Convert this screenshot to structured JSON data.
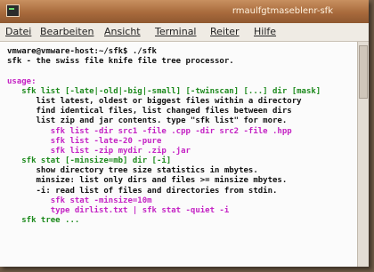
{
  "window": {
    "title": "rmaulfgtmaseblenr-sfk"
  },
  "menu": [
    "Datei",
    "Bearbeiten",
    "Ansicht",
    "Terminal",
    "Reiter",
    "Hilfe"
  ],
  "terminal": {
    "lines": [
      {
        "text": "vmware@vmware-host:~/sfk$ ./sfk",
        "color": "#111111"
      },
      {
        "text": "sfk - the swiss file knife file tree processor.",
        "color": "#111111"
      },
      {
        "text": "",
        "color": "#111111"
      },
      {
        "text": "usage:",
        "color": "#c423c4"
      },
      {
        "text": "   sfk list [-late|-old|-big|-small] [-twinscan] [...] dir [mask]",
        "color": "#1d8a1d"
      },
      {
        "text": "      list latest, oldest or biggest files within a directory",
        "color": "#111111"
      },
      {
        "text": "      find identical files, list changed files between dirs",
        "color": "#111111"
      },
      {
        "text": "      list zip and jar contents. type \"sfk list\" for more.",
        "color": "#111111"
      },
      {
        "text": "         sfk list -dir src1 -file .cpp -dir src2 -file .hpp",
        "color": "#c423c4"
      },
      {
        "text": "         sfk list -late-20 -pure",
        "color": "#c423c4"
      },
      {
        "text": "         sfk list -zip mydir .zip .jar",
        "color": "#c423c4"
      },
      {
        "text": "   sfk stat [-minsize=mb] dir [-i]",
        "color": "#1d8a1d"
      },
      {
        "text": "      show directory tree size statistics in mbytes.",
        "color": "#111111"
      },
      {
        "text": "      minsize: list only dirs and files >= minsize mbytes.",
        "color": "#111111"
      },
      {
        "text": "      -i: read list of files and directories from stdin.",
        "color": "#111111"
      },
      {
        "text": "         sfk stat -minsize=10m",
        "color": "#c423c4"
      },
      {
        "text": "         type dirlist.txt | sfk stat -quiet -i",
        "color": "#c423c4"
      },
      {
        "text": "   sfk tree ...",
        "color": "#1d8a1d"
      }
    ]
  }
}
